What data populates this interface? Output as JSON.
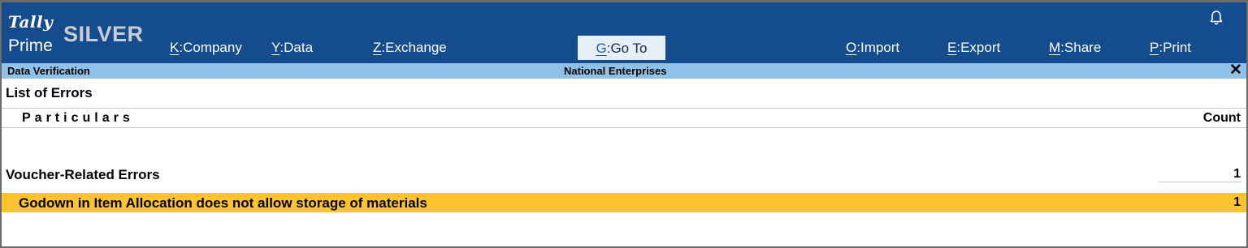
{
  "header": {
    "logo": {
      "brand": "Tally",
      "product": "Prime",
      "edition": "SILVER"
    },
    "menu": [
      {
        "key": "K",
        "label": "Company"
      },
      {
        "key": "Y",
        "label": "Data"
      },
      {
        "key": "Z",
        "label": "Exchange"
      },
      {
        "key": "G",
        "label": "Go To"
      },
      {
        "key": "O",
        "label": "Import"
      },
      {
        "key": "E",
        "label": "Export"
      },
      {
        "key": "M",
        "label": "Share"
      },
      {
        "key": "P",
        "label": "Print"
      }
    ],
    "icons": {
      "notification": "bell-icon"
    },
    "colors": {
      "header_bg": "#144c8e",
      "subheader_bg": "#8ec0e8",
      "highlight": "#fdc42d"
    }
  },
  "subheader": {
    "screen": "Data Verification",
    "company": "National Enterprises",
    "close": "✕"
  },
  "report": {
    "title": "List of Errors",
    "columns": {
      "particulars": "Particulars",
      "count": "Count"
    },
    "groups": [
      {
        "label": "Voucher-Related Errors",
        "count": "1",
        "items": [
          {
            "label": "Godown in Item Allocation does not allow storage of materials",
            "count": "1",
            "selected": true
          }
        ]
      }
    ]
  }
}
